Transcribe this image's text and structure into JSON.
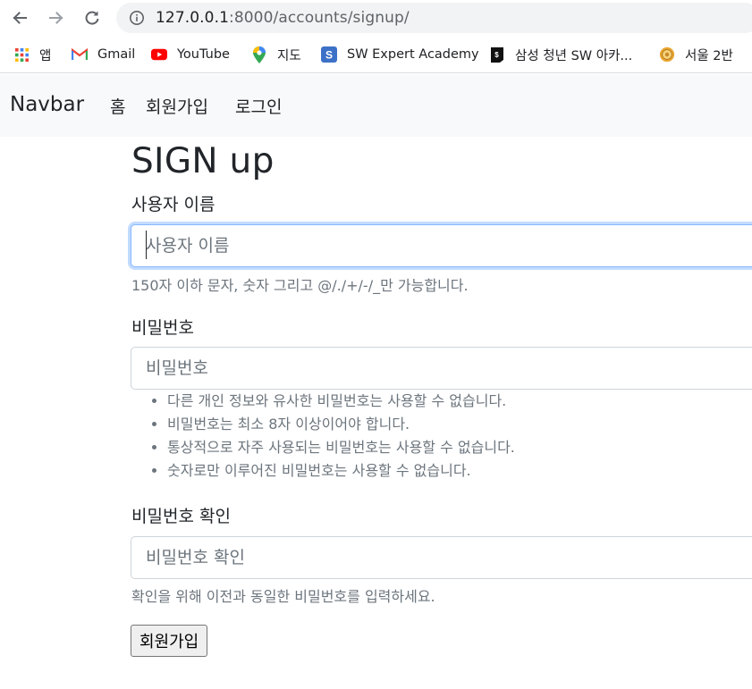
{
  "browser": {
    "url_host": "127.0.0.1",
    "url_rest": ":8000/accounts/signup/",
    "bookmarks": [
      {
        "label": "앱",
        "icon": "apps-grid-icon"
      },
      {
        "label": "Gmail",
        "icon": "gmail-icon"
      },
      {
        "label": "YouTube",
        "icon": "youtube-icon"
      },
      {
        "label": "지도",
        "icon": "maps-pin-icon"
      },
      {
        "label": "SW Expert Academy",
        "icon": "swea-icon"
      },
      {
        "label": "삼성 청년 SW 아카...",
        "icon": "ssafy-icon"
      },
      {
        "label": "서울 2반",
        "icon": "sun-icon"
      }
    ]
  },
  "navbar": {
    "brand": "Navbar",
    "links": [
      "홈",
      "회원가입",
      "로그인"
    ]
  },
  "form": {
    "title": "SIGN up",
    "username": {
      "label": "사용자 이름",
      "placeholder": "사용자 이름",
      "help": "150자 이하 문자, 숫자 그리고 @/./+/-/_만 가능합니다."
    },
    "password1": {
      "label": "비밀번호",
      "placeholder": "비밀번호",
      "rules": [
        "다른 개인 정보와 유사한 비밀번호는 사용할 수 없습니다.",
        "비밀번호는 최소 8자 이상이어야 합니다.",
        "통상적으로 자주 사용되는 비밀번호는 사용할 수 없습니다.",
        "숫자로만 이루어진 비밀번호는 사용할 수 없습니다."
      ]
    },
    "password2": {
      "label": "비밀번호 확인",
      "placeholder": "비밀번호 확인",
      "help": "확인을 위해 이전과 동일한 비밀번호를 입력하세요."
    },
    "submit_label": "회원가입"
  },
  "colors": {
    "navbar_bg": "#f8f9fa",
    "focus_border": "#86b7fe",
    "muted_text": "#6c757d"
  }
}
